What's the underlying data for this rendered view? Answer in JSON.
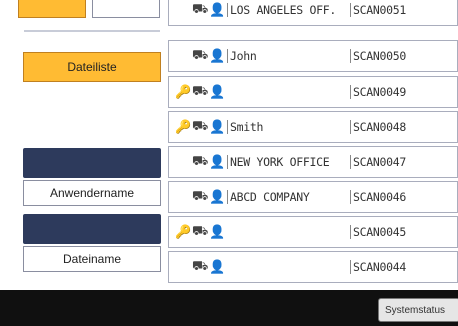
{
  "left_panel": {
    "file_list_button": "Dateiliste",
    "user_name_button": "Anwendername",
    "file_name_button": "Dateiname"
  },
  "rows": [
    {
      "icons": [
        "user-group-icon",
        "person-icon"
      ],
      "name": "LOS ANGELES OFF.",
      "scan": "SCAN0051"
    },
    {
      "icons": [
        "user-group-icon",
        "person-icon"
      ],
      "name": "John",
      "scan": "SCAN0050"
    },
    {
      "icons": [
        "key-icon",
        "user-group-icon",
        "person-icon"
      ],
      "name": "",
      "scan": "SCAN0049"
    },
    {
      "icons": [
        "key-icon",
        "user-group-icon",
        "person-icon"
      ],
      "name": "Smith",
      "scan": "SCAN0048"
    },
    {
      "icons": [
        "user-group-icon",
        "person-icon"
      ],
      "name": "NEW YORK OFFICE",
      "scan": "SCAN0047"
    },
    {
      "icons": [
        "user-group-icon",
        "person-icon"
      ],
      "name": "ABCD COMPANY",
      "scan": "SCAN0046"
    },
    {
      "icons": [
        "key-icon",
        "user-group-icon",
        "person-icon"
      ],
      "name": "",
      "scan": "SCAN0045"
    },
    {
      "icons": [
        "user-group-icon",
        "person-icon"
      ],
      "name": "",
      "scan": "SCAN0044"
    }
  ],
  "bottom_bar": {
    "system_status_button": "Systemstatus"
  },
  "colors": {
    "accent_orange": "#ffbb33",
    "panel_navy": "#2d3a5c",
    "bottom_bar": "#101010"
  }
}
